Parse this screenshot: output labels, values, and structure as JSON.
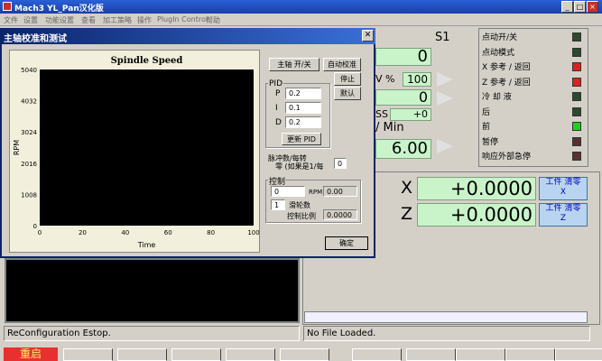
{
  "window": {
    "title": "Mach3 YL_Pan汉化版"
  },
  "menu": [
    "文件",
    "设置",
    "功能设置",
    "查看",
    "加工策略",
    "操作",
    "PlugIn Control",
    "帮助"
  ],
  "dialog": {
    "title": "主轴校准和测试",
    "buttons": {
      "spindle_onoff": "主轴 开/关",
      "auto_calibrate": "自动校准",
      "stop": "停止",
      "default": "默认",
      "update_pid": "更新 PID",
      "ok": "确定"
    },
    "pid": {
      "legend": "PID",
      "p_label": "P",
      "p_value": "0.2",
      "i_label": "I",
      "i_value": "0.1",
      "d_label": "D",
      "d_value": "0.2"
    },
    "pulse": {
      "label_line1": "脉冲数/每转",
      "label_line2": "零 (如果是1/每",
      "value": "0"
    },
    "control": {
      "legend": "控制",
      "rpm_input": "0",
      "rpm_label": "RPM",
      "rpm_value": "0.00",
      "pulley_input": "1",
      "pulley_label": "滑轮数",
      "ratio_label": "控制比例",
      "ratio_value": "0.0000"
    }
  },
  "chart_data": {
    "type": "line",
    "title": "Spindle Speed",
    "xlabel": "Time",
    "ylabel": "RPM",
    "xlim": [
      0,
      100
    ],
    "ylim": [
      0,
      5040
    ],
    "x_ticks": [
      "0",
      "20",
      "40",
      "60",
      "80",
      "100"
    ],
    "y_ticks": [
      "0",
      "1008",
      "2016",
      "3024",
      "4032",
      "5040"
    ],
    "series": []
  },
  "background": {
    "s1_label": "S1",
    "dro_top": "0",
    "ov_label": "V %",
    "ov_value": "100",
    "dro_mid": "0",
    "ss_label": "SS",
    "ss_value": "+0",
    "min_label": "/ Min",
    "feed_value": "6.00"
  },
  "leds": [
    {
      "label": "点动开/关",
      "color": "#2c4a2c"
    },
    {
      "label": "点动模式",
      "color": "#2c4a2c"
    },
    {
      "label": "X 参考 / 返回",
      "color": "#e02020"
    },
    {
      "label": "Z 参考 / 返回",
      "color": "#e02020"
    },
    {
      "label": "冷 却 液",
      "color": "#2c4a2c"
    },
    {
      "label": "后",
      "color": "#2c4a2c"
    },
    {
      "label": "前",
      "color": "#20d020"
    },
    {
      "label": "暂停",
      "color": "#5a3030"
    },
    {
      "label": "响应外部急停",
      "color": "#5a3030"
    }
  ],
  "axes": [
    {
      "name": "X",
      "value": "+0.0000",
      "btn1": "工件",
      "btn2": "清零",
      "sub": "X"
    },
    {
      "name": "Z",
      "value": "+0.0000",
      "btn1": "工件",
      "btn2": "清零",
      "sub": "Z"
    }
  ],
  "status": {
    "left": "ReConfiguration Estop.",
    "right": "No File Loaded."
  },
  "toolbar": {
    "restart": "重启"
  }
}
